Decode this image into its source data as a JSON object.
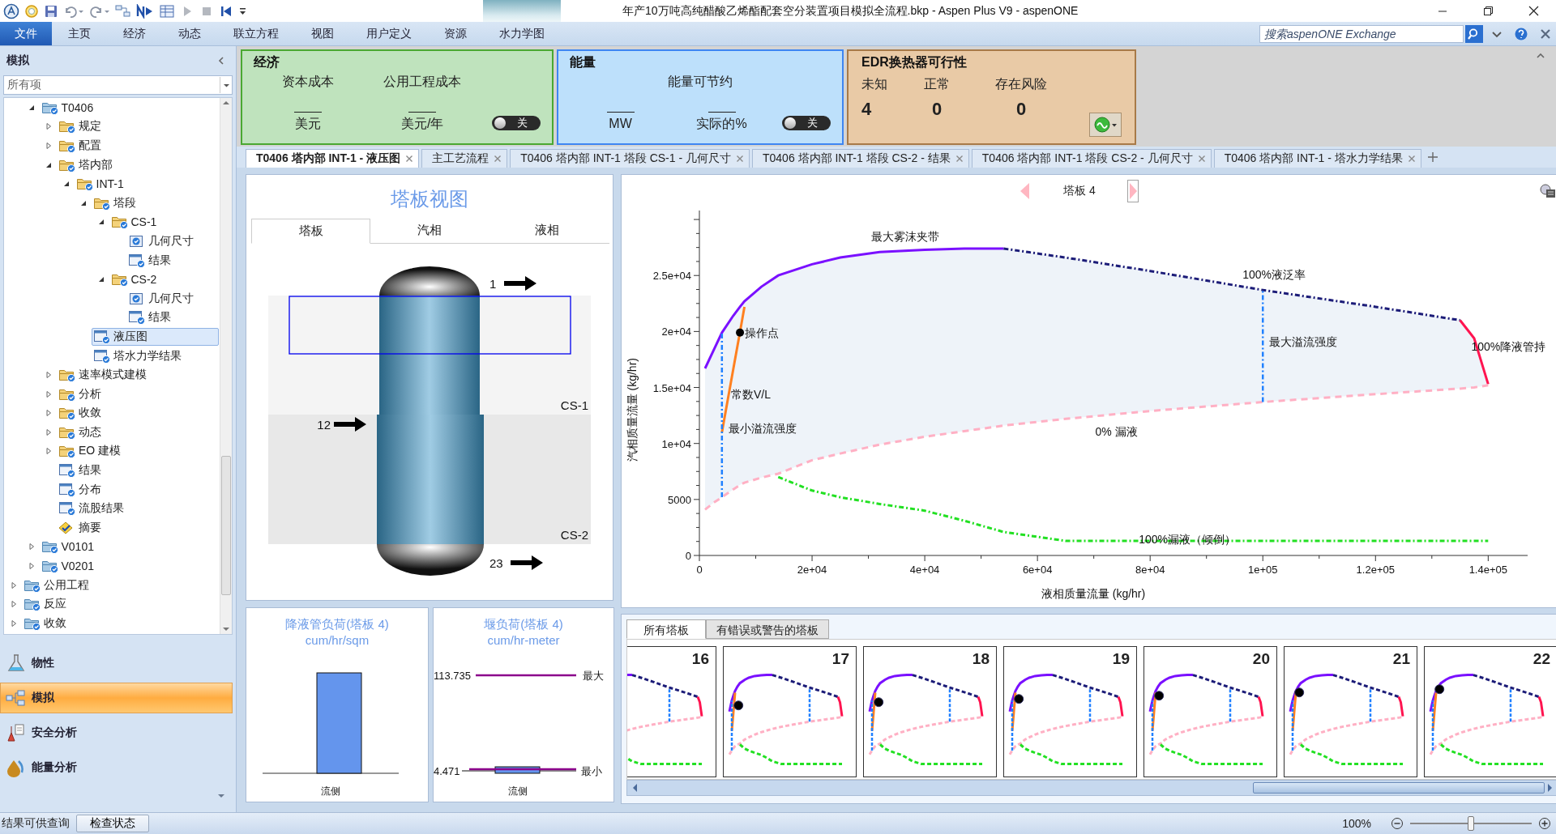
{
  "window": {
    "title": "年产10万吨高纯醋酸乙烯酯配套空分装置项目模拟全流程.bkp - Aspen Plus V9 - aspenONE"
  },
  "ribbon_tabs": [
    {
      "label": "文件",
      "kind": "file"
    },
    {
      "label": "主页",
      "kind": "tab"
    },
    {
      "label": "经济",
      "kind": "tab"
    },
    {
      "label": "动态",
      "kind": "tab"
    },
    {
      "label": "联立方程",
      "kind": "tab"
    },
    {
      "label": "视图",
      "kind": "tab"
    },
    {
      "label": "用户定义",
      "kind": "tab"
    },
    {
      "label": "资源",
      "kind": "tab"
    },
    {
      "label": "水力学图",
      "kind": "contextual"
    }
  ],
  "search": {
    "placeholder": "搜索aspenONE Exchange"
  },
  "economics": {
    "title": "经济",
    "metrics": [
      {
        "label": "资本成本",
        "unit": "美元"
      },
      {
        "label": "公用工程成本",
        "unit": "美元/年"
      }
    ],
    "toggle": {
      "label": "关",
      "on": false
    }
  },
  "energy": {
    "title": "能量",
    "heading": "能量可节约",
    "units": [
      "MW",
      "实际的%"
    ],
    "toggle": {
      "label": "关",
      "on": false
    }
  },
  "edr": {
    "title": "EDR换热器可行性",
    "counts": [
      {
        "label": "未知",
        "value": "4"
      },
      {
        "label": "正常",
        "value": "0"
      },
      {
        "label": "存在风险",
        "value": "0"
      }
    ]
  },
  "sidebar": {
    "title": "模拟",
    "filter": {
      "value": "所有项"
    },
    "tree": [
      {
        "children": [
          {
            "label": "T0406",
            "kind": "block",
            "expanded": true,
            "selected": false,
            "children": [
              {
                "label": "规定",
                "kind": "folder",
                "expanded": false,
                "selected": false
              },
              {
                "label": "配置",
                "kind": "folder",
                "expanded": false,
                "selected": false
              },
              {
                "label": "塔内部",
                "kind": "folder",
                "expanded": true,
                "selected": false,
                "children": [
                  {
                    "label": "INT-1",
                    "kind": "folder",
                    "expanded": true,
                    "selected": false,
                    "children": [
                      {
                        "label": "塔段",
                        "kind": "folder",
                        "expanded": true,
                        "selected": false,
                        "children": [
                          {
                            "label": "CS-1",
                            "kind": "folder",
                            "expanded": true,
                            "selected": false,
                            "children": [
                              {
                                "label": "几何尺寸",
                                "kind": "form",
                                "selected": false
                              },
                              {
                                "label": "结果",
                                "kind": "results",
                                "selected": false
                              }
                            ]
                          },
                          {
                            "label": "CS-2",
                            "kind": "folder",
                            "expanded": true,
                            "selected": false,
                            "children": [
                              {
                                "label": "几何尺寸",
                                "kind": "form",
                                "selected": false
                              },
                              {
                                "label": "结果",
                                "kind": "results",
                                "selected": false
                              }
                            ]
                          }
                        ]
                      },
                      {
                        "label": "液压图",
                        "kind": "results",
                        "selected": true
                      },
                      {
                        "label": "塔水力学结果",
                        "kind": "results",
                        "selected": false
                      }
                    ]
                  }
                ]
              },
              {
                "label": "速率模式建模",
                "kind": "folder",
                "expanded": false,
                "selected": false
              },
              {
                "label": "分析",
                "kind": "folder",
                "expanded": false,
                "selected": false
              },
              {
                "label": "收敛",
                "kind": "folder",
                "expanded": false,
                "selected": false
              },
              {
                "label": "动态",
                "kind": "folder",
                "expanded": false,
                "selected": false
              },
              {
                "label": "EO 建模",
                "kind": "folder",
                "expanded": false,
                "selected": false
              },
              {
                "label": "结果",
                "kind": "results",
                "selected": false
              },
              {
                "label": "分布",
                "kind": "results",
                "selected": false
              },
              {
                "label": "流股结果",
                "kind": "results",
                "selected": false
              },
              {
                "label": "摘要",
                "kind": "summary",
                "selected": false
              }
            ]
          },
          {
            "label": "V0101",
            "kind": "block",
            "expanded": false,
            "selected": false
          },
          {
            "label": "V0201",
            "kind": "block",
            "expanded": false,
            "selected": false
          }
        ]
      },
      {
        "label": "公用工程",
        "kind": "block",
        "expanded": false,
        "selected": false
      },
      {
        "label": "反应",
        "kind": "block",
        "expanded": false,
        "selected": false
      },
      {
        "label": "收敛",
        "kind": "block",
        "expanded": false,
        "selected": false
      }
    ],
    "nav": [
      {
        "label": "物性",
        "kind": "properties",
        "selected": false
      },
      {
        "label": "模拟",
        "kind": "simulation",
        "selected": true
      },
      {
        "label": "安全分析",
        "kind": "safety",
        "selected": false
      },
      {
        "label": "能量分析",
        "kind": "energy",
        "selected": false
      }
    ]
  },
  "document_tabs": [
    {
      "label": "T0406 塔内部 INT-1 - 液压图",
      "selected": true
    },
    {
      "label": "主工艺流程",
      "selected": false
    },
    {
      "label": "T0406 塔内部 INT-1 塔段 CS-1 - 几何尺寸",
      "selected": false
    },
    {
      "label": "T0406 塔内部 INT-1 塔段 CS-2 - 结果",
      "selected": false
    },
    {
      "label": "T0406 塔内部 INT-1 塔段 CS-2 - 几何尺寸",
      "selected": false
    },
    {
      "label": "T0406 塔内部 INT-1 - 塔水力学结果",
      "selected": false
    }
  ],
  "tray_view": {
    "title": "塔板视图",
    "tabs": [
      {
        "label": "塔板",
        "selected": true
      },
      {
        "label": "汽相",
        "selected": false
      },
      {
        "label": "液相",
        "selected": false
      }
    ],
    "sections": [
      {
        "label": "CS-1"
      },
      {
        "label": "CS-2"
      }
    ],
    "streams": [
      {
        "label": "1",
        "kind": "top"
      },
      {
        "label": "12",
        "kind": "feed"
      },
      {
        "label": "23",
        "kind": "bottom"
      }
    ]
  },
  "downcomer_load": {
    "title": "降液管负荷(塔板 4)",
    "unit": "cum/hr/sqm",
    "xlabel": "流侧"
  },
  "weir_load": {
    "title": "堰负荷(塔板 4)",
    "unit": "cum/hr-meter",
    "max": {
      "value": "113.735",
      "label": "最大"
    },
    "min": {
      "value": "4.471",
      "label": "最小"
    },
    "xlabel": "流侧"
  },
  "hydraulics": {
    "tray_label": "塔板 4",
    "chart_data": {
      "type": "line",
      "xlabel": "液相质量流量 (kg/hr)",
      "ylabel": "汽相质量流量 (kg/hr)",
      "x": [
        1000,
        2500,
        4000,
        6000,
        7200,
        8000,
        11000,
        14000,
        20000,
        25000,
        32000,
        40000,
        47000,
        54000,
        65000,
        80000,
        100000,
        120000,
        135000,
        137500,
        140000
      ],
      "series": [
        {
          "name": "最大雾沫夹带",
          "color": "#7a10ff",
          "line_style": "solid",
          "values": [
            16700,
            18300,
            19900,
            21400,
            22200,
            22700,
            24000,
            25000,
            26000,
            26600,
            27100,
            27300,
            27400,
            27400,
            null,
            null,
            null,
            null,
            null,
            null,
            null
          ]
        },
        {
          "name": "100%液泛率",
          "color": "#1c1c78",
          "line_style": "dashdot",
          "values": [
            null,
            null,
            null,
            null,
            null,
            null,
            null,
            null,
            null,
            null,
            null,
            null,
            null,
            27400,
            26600,
            25400,
            23700,
            22200,
            21000,
            null,
            null
          ]
        },
        {
          "name": "100%降液管持",
          "color": "#ff1450",
          "line_style": "solid",
          "values": [
            null,
            null,
            null,
            null,
            null,
            null,
            null,
            null,
            null,
            null,
            null,
            null,
            null,
            null,
            null,
            null,
            null,
            null,
            21000,
            19400,
            15300
          ]
        },
        {
          "name": "0% 漏液",
          "color": "#ffb0c4",
          "line_style": "dashed",
          "values": [
            4100,
            4700,
            5200,
            5900,
            6300,
            6500,
            6950,
            7300,
            8500,
            9100,
            9900,
            10600,
            11100,
            11600,
            12200,
            12900,
            13700,
            14400,
            14900,
            15000,
            15200
          ]
        },
        {
          "name": "100%漏液（倾倒）",
          "color": "#22e022",
          "line_style": "dashdot",
          "values": [
            null,
            null,
            null,
            null,
            null,
            null,
            null,
            7000,
            5800,
            5200,
            4600,
            4000,
            3100,
            2100,
            1300,
            1300,
            1300,
            1300,
            1300,
            1300,
            1300
          ]
        },
        {
          "name": "常数V/L",
          "color": "#ff8020",
          "line_style": "solid",
          "values": [
            null,
            null,
            11000,
            16600,
            19960,
            22200,
            null,
            null,
            null,
            null,
            null,
            null,
            null,
            null,
            null,
            null,
            null,
            null,
            null,
            null,
            null
          ]
        },
        {
          "name": "操作点",
          "color": "#000000",
          "line_style": "none",
          "marker": "circle",
          "values": [
            null,
            null,
            null,
            null,
            19900,
            null,
            null,
            null,
            null,
            null,
            null,
            null,
            null,
            null,
            null,
            null,
            null,
            null,
            null,
            null,
            null
          ]
        }
      ],
      "xlim": [
        0,
        147000
      ],
      "ylim": [
        0,
        30800
      ],
      "xticks": [
        {
          "value": 0,
          "label": "0"
        },
        {
          "value": 20000,
          "label": "2e+04"
        },
        {
          "value": 40000,
          "label": "4e+04"
        },
        {
          "value": 60000,
          "label": "6e+04"
        },
        {
          "value": 80000,
          "label": "8e+04"
        },
        {
          "value": 100000,
          "label": "1e+05"
        },
        {
          "value": 120000,
          "label": "1.2e+05"
        },
        {
          "value": 140000,
          "label": "1.4e+05"
        }
      ],
      "yticks": [
        {
          "value": 0,
          "label": "0"
        },
        {
          "value": 5000,
          "label": "5000"
        },
        {
          "value": 10000,
          "label": "1e+04"
        },
        {
          "value": 15000,
          "label": "1.5e+04"
        },
        {
          "value": 20000,
          "label": "2e+04"
        },
        {
          "value": 25000,
          "label": "2.5e+04"
        }
      ],
      "ref_lines": [
        {
          "axis": "x",
          "value": 4000,
          "label": "最小溢流强度",
          "color": "#2080ff"
        },
        {
          "axis": "x",
          "value": 100000,
          "label": "最大溢流强度",
          "color": "#2080ff"
        }
      ]
    }
  },
  "tray_list": {
    "tabs": [
      {
        "label": "所有塔板",
        "selected": true
      },
      {
        "label": "有错误或警告的塔板",
        "selected": false
      }
    ],
    "trays": [
      {
        "label": "16"
      },
      {
        "label": "17"
      },
      {
        "label": "18"
      },
      {
        "label": "19"
      },
      {
        "label": "20"
      },
      {
        "label": "21"
      },
      {
        "label": "22"
      }
    ]
  },
  "status_bar": {
    "message": "结果可供查询",
    "button": "检查状态",
    "zoom": {
      "label": "100%",
      "level": 0.5
    }
  }
}
